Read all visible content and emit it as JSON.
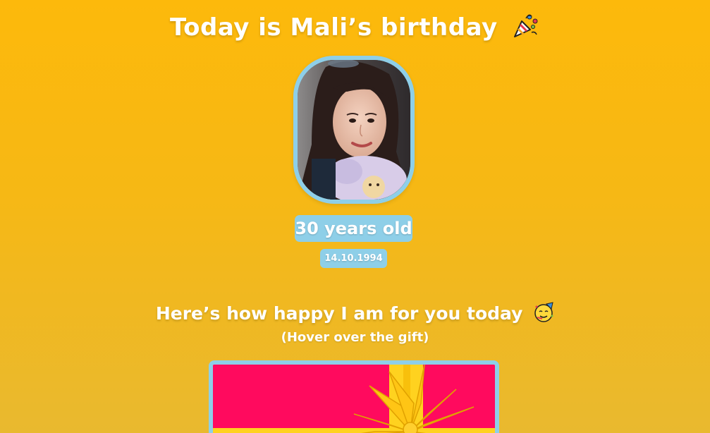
{
  "header": {
    "title": "Today is Mali’s birthday",
    "title_icon": "party-popper-icon"
  },
  "profile": {
    "photo_alt": "Mali",
    "age_text": "30 years old",
    "birth_date": "14.10.1994"
  },
  "happiness_section": {
    "heading": "Here’s how happy I am for you today",
    "heading_icon": "partying-face-icon",
    "hint": "(Hover over the gift)"
  },
  "gift": {
    "box_color": "#ff0a5e",
    "ribbon_color": "#ffd21f",
    "frame_color": "#8ecfe8"
  },
  "colors": {
    "background_top": "#fdb90b",
    "background_bottom": "#e9b92f",
    "accent": "#8ecfe8",
    "text": "#ffffff"
  }
}
